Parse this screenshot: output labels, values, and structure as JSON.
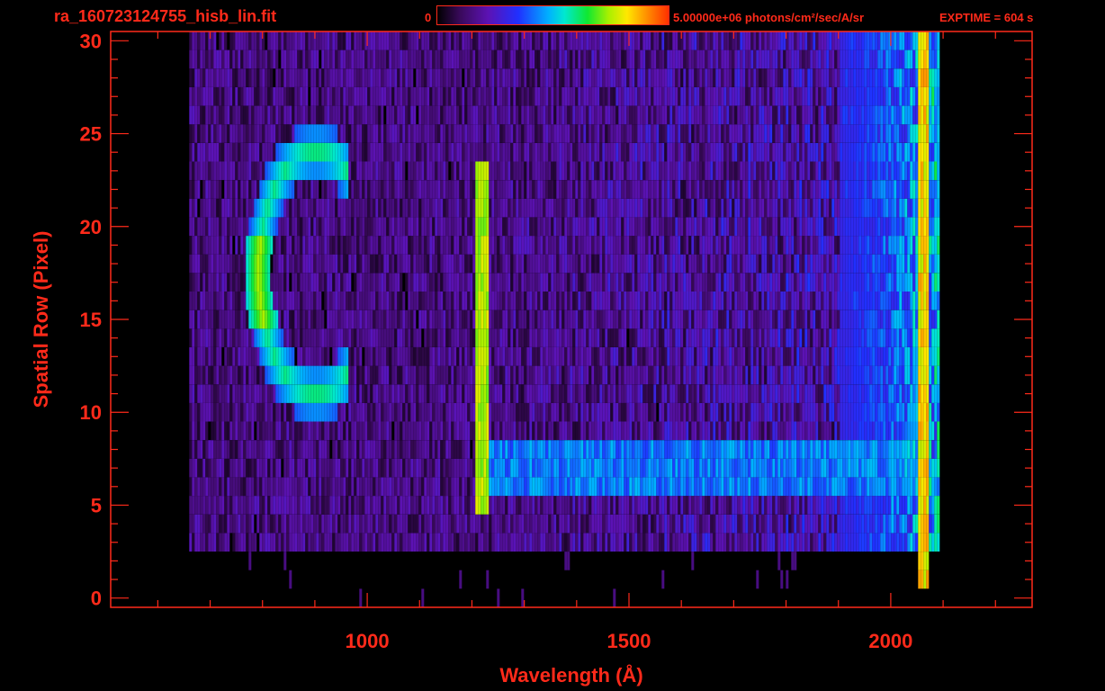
{
  "header": {
    "file_name": "ra_160723124755_hisb_lin.fit",
    "colorbar_min": "0",
    "colorbar_max_label": "5.00000e+06 photons/cm²/sec/A/sr",
    "exptime": "EXPTIME = 604 s"
  },
  "colors": {
    "axis": "#ff2a1a",
    "background": "#000000"
  },
  "chart_data": {
    "type": "heatmap",
    "title": "ra_160723124755_hisb_lin.fit",
    "xlabel": "Wavelength (Å)",
    "ylabel": "Spatial Row (Pixel)",
    "xlim": [
      510,
      2270
    ],
    "ylim": [
      -0.5,
      30.5
    ],
    "x_ticks": [
      1000,
      1500,
      2000
    ],
    "x_tick_labels": [
      "1000",
      "1500",
      "2000"
    ],
    "y_ticks": [
      0,
      5,
      10,
      15,
      20,
      25,
      30
    ],
    "y_tick_labels": [
      "0",
      "5",
      "10",
      "15",
      "20",
      "25",
      "30"
    ],
    "colorbar": {
      "min": 0,
      "max": 5000000,
      "units": "photons/cm²/sec/A/sr",
      "colormap": "rainbow"
    },
    "features": [
      {
        "kind": "vertical_emission_line",
        "wavelength": 1216,
        "rows": [
          5,
          23
        ],
        "level": 0.7
      },
      {
        "kind": "arc",
        "wavelength_range": [
          780,
          960
        ],
        "rows": [
          11,
          24
        ],
        "level": 0.6
      },
      {
        "kind": "horizontal_band",
        "wavelength_range": [
          1216,
          2060
        ],
        "rows": [
          6,
          8
        ],
        "level": 0.45
      },
      {
        "kind": "red_edge",
        "wavelength": 2060,
        "rows": [
          1,
          30
        ],
        "level": 0.75
      }
    ]
  }
}
